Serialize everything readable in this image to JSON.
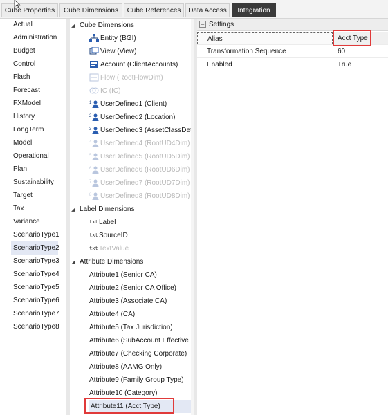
{
  "tabs": [
    "Cube Properties",
    "Cube Dimensions",
    "Cube References",
    "Data Access",
    "Integration"
  ],
  "active_tab": "Integration",
  "scenario_types": [
    "Actual",
    "Administration",
    "Budget",
    "Control",
    "Flash",
    "Forecast",
    "FXModel",
    "History",
    "LongTerm",
    "Model",
    "Operational",
    "Plan",
    "Sustainability",
    "Target",
    "Tax",
    "Variance",
    "ScenarioType1",
    "ScenarioType2",
    "ScenarioType3",
    "ScenarioType4",
    "ScenarioType5",
    "ScenarioType6",
    "ScenarioType7",
    "ScenarioType8"
  ],
  "selected_scenario_type": "ScenarioType2",
  "tree": {
    "cube_dimensions_label": "Cube Dimensions",
    "cube_dimensions": [
      {
        "name": "Entity",
        "value": "(BGI)",
        "icon": "entity-icon",
        "enabled": true
      },
      {
        "name": "View",
        "value": "(View)",
        "icon": "view-icon",
        "enabled": true
      },
      {
        "name": "Account",
        "value": "(ClientAccounts)",
        "icon": "account-icon",
        "enabled": true
      },
      {
        "name": "Flow",
        "value": "(RootFlowDim)",
        "icon": "flow-icon",
        "enabled": false
      },
      {
        "name": "IC",
        "value": "(IC)",
        "icon": "ic-icon",
        "enabled": false
      },
      {
        "name": "UserDefined1",
        "value": "(Client)",
        "icon": "ud1-icon",
        "enabled": true
      },
      {
        "name": "UserDefined2",
        "value": "(Location)",
        "icon": "ud2-icon",
        "enabled": true
      },
      {
        "name": "UserDefined3",
        "value": "(AssetClassDet",
        "icon": "ud3-icon",
        "enabled": true
      },
      {
        "name": "UserDefined4",
        "value": "(RootUD4Dim)",
        "icon": "ud4-icon",
        "enabled": false
      },
      {
        "name": "UserDefined5",
        "value": "(RootUD5Dim)",
        "icon": "ud5-icon",
        "enabled": false
      },
      {
        "name": "UserDefined6",
        "value": "(RootUD6Dim)",
        "icon": "ud6-icon",
        "enabled": false
      },
      {
        "name": "UserDefined7",
        "value": "(RootUD7Dim)",
        "icon": "ud7-icon",
        "enabled": false
      },
      {
        "name": "UserDefined8",
        "value": "(RootUD8Dim)",
        "icon": "ud8-icon",
        "enabled": false
      }
    ],
    "label_dimensions_label": "Label Dimensions",
    "label_dimensions": [
      {
        "name": "Label",
        "enabled": true
      },
      {
        "name": "SourceID",
        "enabled": true
      },
      {
        "name": "TextValue",
        "enabled": false
      }
    ],
    "label_icon_text": "txt",
    "attribute_dimensions_label": "Attribute Dimensions",
    "attribute_dimensions": [
      {
        "name": "Attribute1",
        "value": "(Senior CA)"
      },
      {
        "name": "Attribute2",
        "value": "(Senior CA Office)"
      },
      {
        "name": "Attribute3",
        "value": "(Associate CA)"
      },
      {
        "name": "Attribute4",
        "value": "(CA)"
      },
      {
        "name": "Attribute5",
        "value": "(Tax Jurisdiction)"
      },
      {
        "name": "Attribute6",
        "value": "(SubAccount Effective"
      },
      {
        "name": "Attribute7",
        "value": "(Checking Corporate)"
      },
      {
        "name": "Attribute8",
        "value": "(AAMG Only)"
      },
      {
        "name": "Attribute9",
        "value": "(Family Group Type)"
      },
      {
        "name": "Attribute10",
        "value": "(Category)"
      },
      {
        "name": "Attribute11",
        "value": "(Acct Type)"
      }
    ],
    "selected_attribute": "Attribute11"
  },
  "settings": {
    "header": "Settings",
    "rows": [
      {
        "key": "Alias",
        "value": "Acct Type"
      },
      {
        "key": "Transformation Sequence",
        "value": "60"
      },
      {
        "key": "Enabled",
        "value": "True"
      }
    ]
  },
  "colors": {
    "active_tab_bg": "#3a3a3a",
    "highlight_box": "#e03a3a",
    "selection_bg": "#e3e8f4",
    "disabled_text": "#b8b8b8"
  }
}
